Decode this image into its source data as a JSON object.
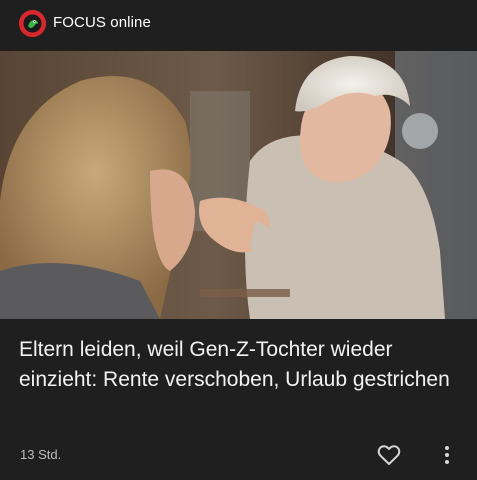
{
  "source": {
    "name": "FOCUS online",
    "logo_icon": "focus-frog-logo"
  },
  "article": {
    "headline": "Eltern leiden, weil Gen-Z-Tochter wieder einzieht: Rente verschoben, Urlaub gestrichen",
    "age": "13 Std."
  },
  "actions": {
    "like_icon": "heart-outline-icon",
    "more_icon": "more-vertical-icon"
  },
  "colors": {
    "background": "#1f1f1f",
    "brand": "#d7282f",
    "secondary_text": "#bdbdbd"
  }
}
